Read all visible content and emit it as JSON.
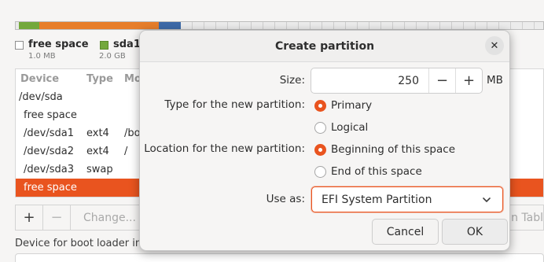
{
  "background": {
    "legend": [
      {
        "name": "free space",
        "size": "1.0 MB",
        "swatch": "#ffffff"
      },
      {
        "name": "sda1",
        "size": "2.0 GB",
        "swatch": "#73a83c"
      }
    ],
    "table": {
      "headers": [
        "Device",
        "Type",
        "Mo"
      ],
      "rows": [
        {
          "device": "/dev/sda",
          "type": "",
          "mount": ""
        },
        {
          "device": "free space",
          "type": "",
          "mount": ""
        },
        {
          "device": "/dev/sda1",
          "type": "ext4",
          "mount": "/bo"
        },
        {
          "device": "/dev/sda2",
          "type": "ext4",
          "mount": "/"
        },
        {
          "device": "/dev/sda3",
          "type": "swap",
          "mount": ""
        },
        {
          "device": "free space",
          "type": "",
          "mount": ""
        }
      ]
    },
    "toolbar": {
      "add_label": "+",
      "remove_label": "−",
      "change_label": "Change...",
      "new_table_label": "n Tabl"
    },
    "bootloader_label": "Device for boot loader installation:"
  },
  "dialog": {
    "title": "Create partition",
    "close_icon": "close-icon",
    "size_label": "Size:",
    "size_value": "250",
    "size_unit": "MB",
    "decrement_label": "−",
    "increment_label": "+",
    "type_label": "Type for the new partition:",
    "type_options": [
      "Primary",
      "Logical"
    ],
    "type_selected": "Primary",
    "location_label": "Location for the new partition:",
    "location_options": [
      "Beginning of this space",
      "End of this space"
    ],
    "location_selected": "Beginning of this space",
    "use_as_label": "Use as:",
    "use_as_value": "EFI System Partition",
    "cancel_label": "Cancel",
    "ok_label": "OK"
  },
  "colors": {
    "accent": "#e9541f",
    "ext4_green": "#73a83c",
    "partition_orange": "#e77e2b",
    "swap_blue": "#3d6aa8"
  }
}
